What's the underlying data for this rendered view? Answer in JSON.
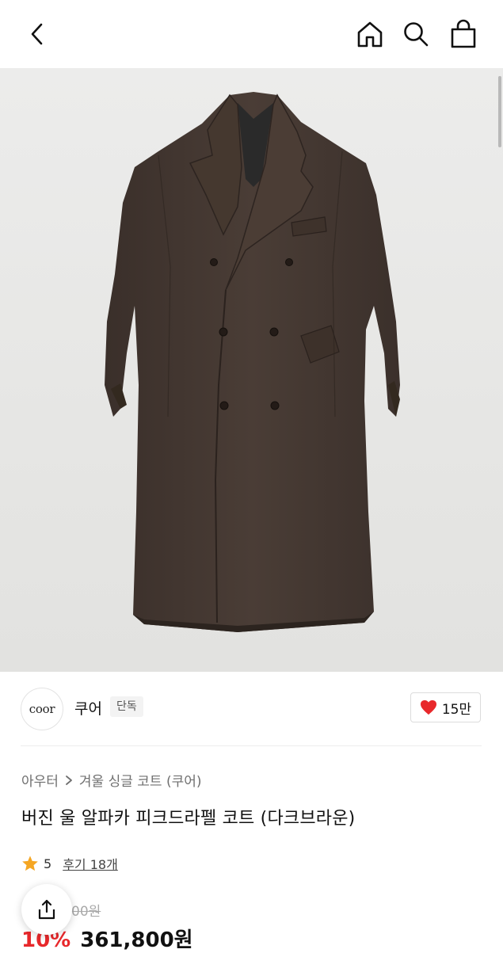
{
  "header": {
    "back_icon": "chevron-left-icon",
    "home_icon": "home-icon",
    "search_icon": "search-icon",
    "cart_icon": "shopping-bag-icon"
  },
  "product_image": {
    "subject": "coat-photo"
  },
  "brand": {
    "logo_text": "coor",
    "name": "쿠어",
    "badge": "단독",
    "like_count": "15만",
    "like_icon": "heart-icon",
    "like_color": "#e8282b"
  },
  "breadcrumb": {
    "category": "아우터",
    "subcategory": "겨울 싱글 코트 (쿠어)"
  },
  "product": {
    "title": "버진 울 알파카 피크드라펠 코트 (다크브라운)",
    "rating": "5",
    "review_label": "후기 18개",
    "star_color": "#f5a623",
    "original_price_partial": "00원",
    "discount": "10%",
    "sale_price": "361,800원"
  },
  "floating": {
    "share_icon": "share-icon"
  }
}
